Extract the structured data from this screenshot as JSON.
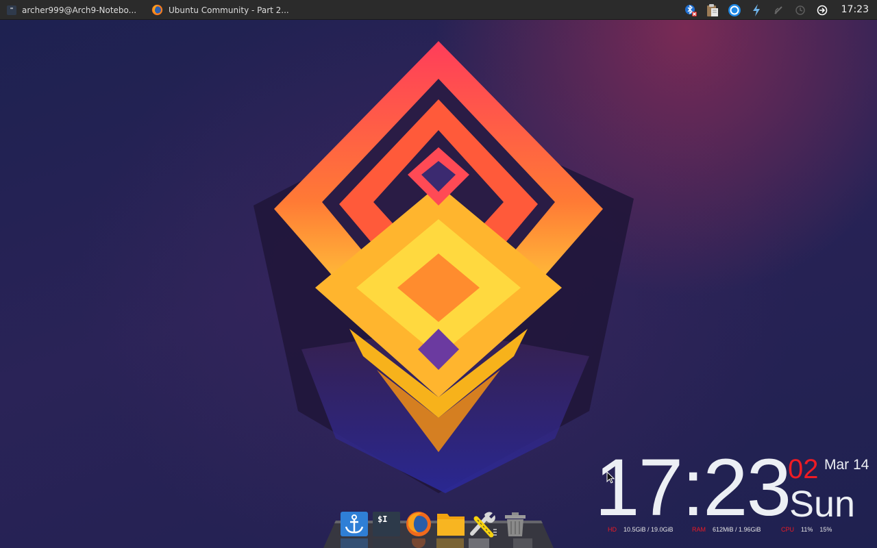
{
  "taskbar": {
    "tasks": [
      {
        "label": "archer999@Arch9-Notebo...",
        "icon": "terminal-icon"
      },
      {
        "label": "Ubuntu Community - Part 2...",
        "icon": "firefox-icon"
      }
    ],
    "tray": [
      "bluetooth-disabled-icon",
      "clipboard-icon",
      "network-icon",
      "power-icon",
      "redshift-icon",
      "update-icon",
      "logout-icon"
    ],
    "terminal_glyph": "\"",
    "clock": "17:23"
  },
  "widget": {
    "time": "17:23",
    "seconds": "02",
    "date": "Mar 14",
    "weekday": "Sun",
    "hd_label": "HD",
    "hd_value": "10.5GiB / 19.0GiB",
    "ram_label": "RAM",
    "ram_value": "612MiB / 1.96GiB",
    "cpu_label": "CPU",
    "cpu_value1": "11%",
    "cpu_value2": "15%"
  },
  "dock": {
    "items": [
      "anchor-icon",
      "terminal-icon",
      "firefox-icon",
      "folder-icon",
      "settings-tools-icon",
      "trash-icon"
    ],
    "terminal_text": "$I"
  },
  "colors": {
    "accent_red": "#ee1b24",
    "panel_bg": "#2b2b2b",
    "text": "#eceff4"
  }
}
